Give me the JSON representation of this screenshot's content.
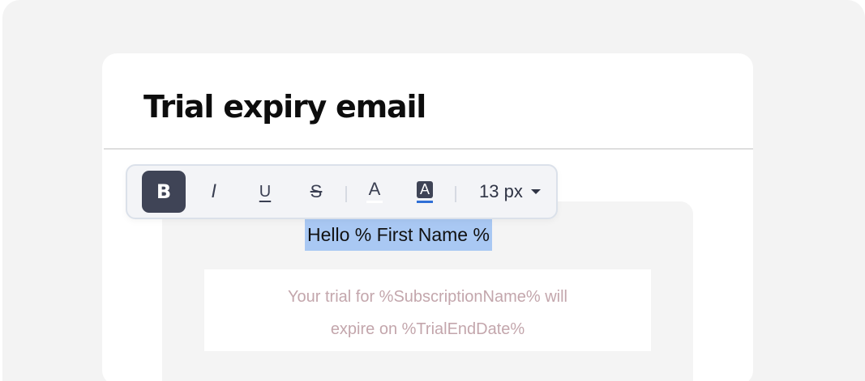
{
  "card": {
    "title": "Trial expiry email"
  },
  "email": {
    "greeting": "Hello % First Name %",
    "message_line1": "Your trial for %SubscriptionName% will",
    "message_line2": "expire on %TrialEndDate%"
  },
  "toolbar": {
    "bold_label": "B",
    "italic_label": "I",
    "underline_label": "U",
    "strikethrough_label": "S",
    "text_color_label": "A",
    "highlight_label": "A",
    "font_size": "13 px",
    "bold_active": true,
    "icons": [
      "bold-icon",
      "italic-icon",
      "underline-icon",
      "strikethrough-icon",
      "text-color-icon",
      "highlight-color-icon",
      "chevron-down-icon"
    ]
  },
  "colors": {
    "selection_highlight": "#a9c8f3",
    "highlight_underline": "#2f6fd6",
    "toolbar_active": "#3f4456",
    "placeholder_text": "#c3a6ac"
  }
}
